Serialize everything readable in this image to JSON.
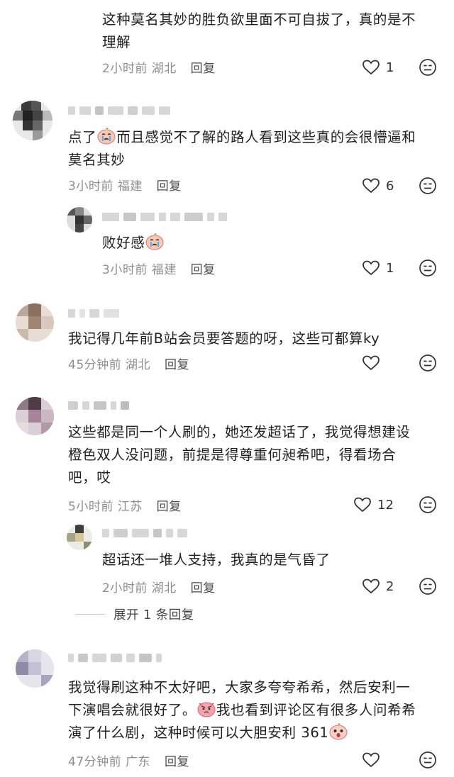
{
  "comments": [
    {
      "text_lines": [
        "这种莫名其妙的胜负欲里面不可自拔了，真的是不",
        "理解"
      ],
      "time": "2小时前",
      "location": "湖北",
      "reply_label": "回复",
      "likes": "1"
    },
    {
      "text_prefix": "点了",
      "emoji_1": "crying-emoji",
      "text_line1_rest": "而且感觉不了解的路人看到这些真的会很懵逼和",
      "text_line2": "莫名其妙",
      "time": "3小时前",
      "location": "福建",
      "reply_label": "回复",
      "likes": "6",
      "reply": {
        "text": "败好感",
        "emoji": "crying-emoji",
        "time": "3小时前",
        "location": "福建",
        "reply_label": "回复",
        "likes": "1"
      }
    },
    {
      "text_lines": [
        "我记得几年前B站会员要答题的呀，这些可都算ky"
      ],
      "time": "45分钟前",
      "location": "湖北",
      "reply_label": "回复",
      "likes": ""
    },
    {
      "text_lines": [
        "这些都是同一个人刷的，她还发超话了，我觉得想建设",
        "橙色双人没问题，前提是得尊重何昶希吧，得看场合",
        "吧，哎"
      ],
      "time": "5小时前",
      "location": "江苏",
      "reply_label": "回复",
      "likes": "12",
      "reply": {
        "text": "超话还一堆人支持，我真的是气昏了",
        "time": "2小时前",
        "location": "湖北",
        "reply_label": "回复",
        "likes": "2"
      },
      "expand_label": "展开 1 条回复"
    },
    {
      "text_line1": "我觉得刷这种不太好吧，大家多夸夸希希，然后安利一",
      "text_line2_a": "下演唱会就很好了。",
      "emoji_2": "angry-emoji",
      "text_line2_b": "我也看到评论区有很多人问希希",
      "text_line3": "演了什么剧，这种时候可以大胆安利 361",
      "emoji_3": "shocked-emoji",
      "time": "47分钟前",
      "location": "广东",
      "reply_label": "回复",
      "likes": ""
    }
  ],
  "colors": {
    "text": "#1f1f1f",
    "meta": "#8e8e8e",
    "icon": "#333333"
  }
}
